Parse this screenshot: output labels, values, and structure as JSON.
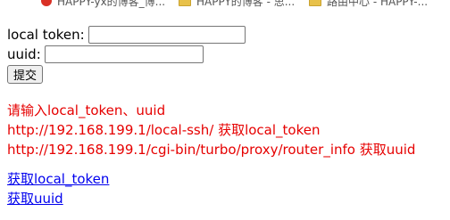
{
  "browser_tabs": [
    {
      "label": "HAPPY-yx的博客_博...",
      "icon": "red-circle-icon"
    },
    {
      "label": "HAPPY的博客 - 思...",
      "icon": "folder-icon"
    },
    {
      "label": "路由中心 - HAPPY-...",
      "icon": "folder-icon"
    }
  ],
  "form": {
    "local_token_label": "local token:",
    "local_token_value": "",
    "uuid_label": "uuid:",
    "uuid_value": "",
    "submit_label": "提交"
  },
  "notes": {
    "line1": "请输入local_token、uuid",
    "line2": "http://192.168.199.1/local-ssh/ 获取local_token",
    "line3": "http://192.168.199.1/cgi-bin/turbo/proxy/router_info 获取uuid"
  },
  "links": {
    "get_token": "获取local_token",
    "get_uuid": "获取uuid"
  },
  "colors": {
    "note_red": "#e60000",
    "link_blue": "#0000ee"
  }
}
